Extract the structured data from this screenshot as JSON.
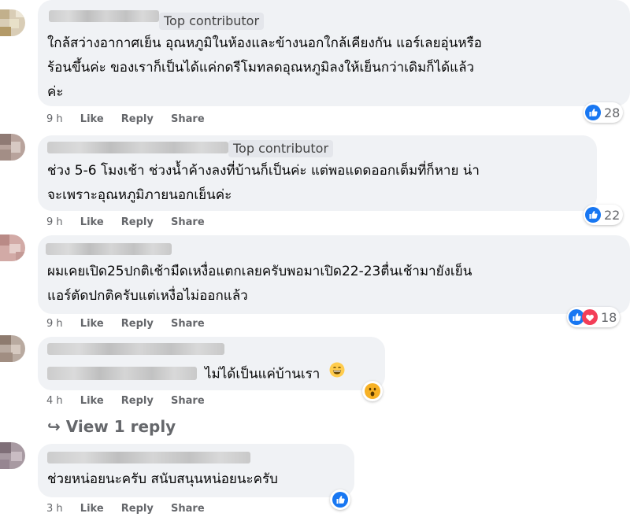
{
  "comments": [
    {
      "badge": "Top contributor",
      "lines": [
        "ใกล้สว่างอากาศเย็น อุณหภูมิในห้องและข้างนอกใกล้เคียงกัน แอร์เลยอุ่นหรือ",
        "ร้อนขึ้นค่ะ ของเราก็เป็นได้แค่กดรีโมทลดอุณหภูมิลงให้เย็นกว่าเดิมก็ได้แล้ว",
        "ค่ะ"
      ],
      "time": "9 h",
      "like": "Like",
      "reply": "Reply",
      "share": "Share",
      "reaction_count": "28",
      "reactions": [
        "like"
      ]
    },
    {
      "badge": "Top contributor",
      "lines": [
        "ช่วง 5-6 โมงเช้า ช่วงน้ำค้างลงที่บ้านก็เป็นค่ะ แต่พอแดดออกเต็มที่ก็หาย น่า",
        "จะเพราะอุณหภูมิภายนอกเย็นค่ะ"
      ],
      "time": "9 h",
      "like": "Like",
      "reply": "Reply",
      "share": "Share",
      "reaction_count": "22",
      "reactions": [
        "like"
      ]
    },
    {
      "badge": "",
      "lines": [
        "ผมเคยเปิด25ปกติเช้ามืดเหงื่อแตกเลยครับพอมาเปิด22-23ตื่นเช้ามายังเย็น",
        "แอร์ตัดปกติครับแต่เหงื่อไม่ออกแล้ว"
      ],
      "time": "9 h",
      "like": "Like",
      "reply": "Reply",
      "share": "Share",
      "reaction_count": "18",
      "reactions": [
        "like",
        "love"
      ]
    },
    {
      "badge": "",
      "lines": [
        "ไม่ได้เป็นแค่บ้านเรา"
      ],
      "time": "4 h",
      "like": "Like",
      "reply": "Reply",
      "share": "Share",
      "reaction_count": "",
      "reactions": [
        "wow"
      ]
    },
    {
      "badge": "",
      "lines": [
        "ช่วยหน่อยนะครับ สนับสนุนหน่อยนะครับ"
      ],
      "time": "3 h",
      "like": "Like",
      "reply": "Reply",
      "share": "Share",
      "reaction_count": "",
      "reactions": [
        "like"
      ]
    }
  ],
  "view_replies": "↪ View 1 reply",
  "colors": {
    "bubble": "#f0f2f5",
    "meta_text": "#65676b",
    "like_blue": "#1877f2",
    "love_red": "#f33e58",
    "wow_yellow": "#f7b125"
  },
  "icons": [
    "like-reaction-icon",
    "love-reaction-icon",
    "wow-reaction-icon",
    "grinning-emoji-icon",
    "reply-arrow-icon"
  ]
}
